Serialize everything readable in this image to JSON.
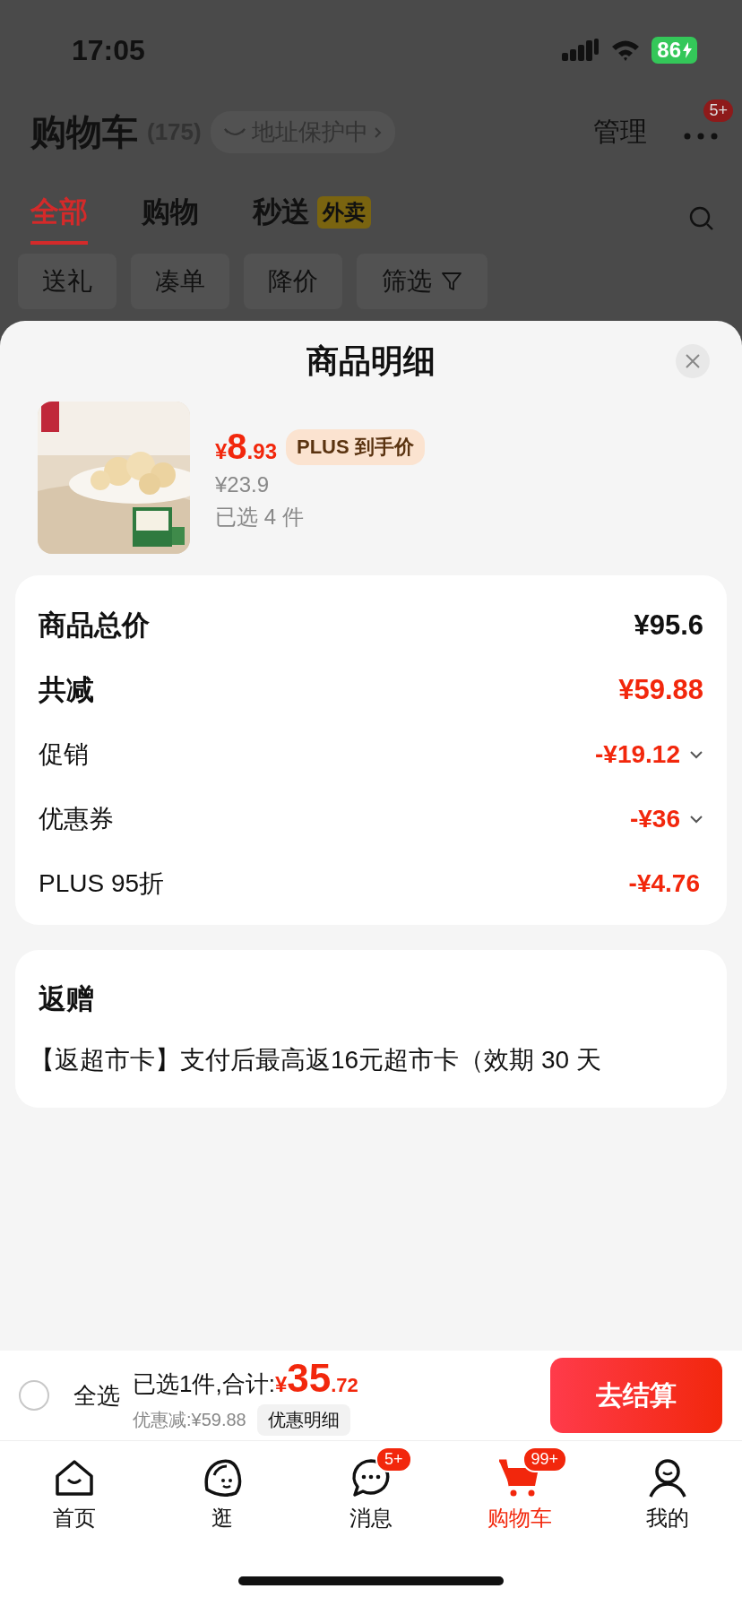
{
  "status_bar": {
    "time": "17:05",
    "battery": "86"
  },
  "header": {
    "title": "购物车",
    "count": "(175)",
    "address_badge": "地址保护中",
    "manage": "管理",
    "more_badge": "5+"
  },
  "tabs": [
    {
      "label": "全部",
      "selected": true
    },
    {
      "label": "购物",
      "selected": false
    },
    {
      "label": "秒送",
      "tag": "外卖",
      "selected": false
    }
  ],
  "filters": [
    {
      "label": "送礼",
      "kind": "chip"
    },
    {
      "label": "凑单",
      "kind": "chip"
    },
    {
      "label": "降价",
      "kind": "chip"
    },
    {
      "label": "筛选",
      "kind": "filter"
    }
  ],
  "sheet": {
    "title": "商品明细",
    "product": {
      "kind": "picture",
      "price_symbol": "¥",
      "price_int": "8",
      "price_dec": ".93",
      "plus_tag": "PLUS 到手价",
      "original_price": "¥23.9",
      "quantity": "已选 4 件"
    },
    "summary": [
      {
        "label": "商品总价",
        "value": "¥95.6",
        "kind": "total"
      },
      {
        "label": "共减",
        "value": "¥59.88",
        "kind": "discount_total"
      },
      {
        "label": "促销",
        "value": "-¥19.12",
        "kind": "detail",
        "expandable": true
      },
      {
        "label": "优惠券",
        "value": "-¥36",
        "kind": "detail",
        "expandable": true
      },
      {
        "label": "PLUS 95折",
        "value": "-¥4.76",
        "kind": "detail",
        "expandable": false
      }
    ],
    "rebate": {
      "title": "返赠",
      "text": "【返超市卡】支付后最高返16元超市卡（效期 30 天"
    }
  },
  "checkout_bar": {
    "select_all": {
      "label": "全选",
      "checked": false
    },
    "summary": "已选1件,合计:",
    "total_symbol": "¥",
    "total_int": "35",
    "total_dec": ".72",
    "discount": "优惠减:¥59.88",
    "detail_button": "优惠明细",
    "checkout": "去结算"
  },
  "nav": [
    {
      "label": "首页",
      "kind": "home",
      "selected": false
    },
    {
      "label": "逛",
      "kind": "browse",
      "selected": false
    },
    {
      "label": "消息",
      "kind": "messages",
      "badge": "5+",
      "selected": false
    },
    {
      "label": "购物车",
      "kind": "cart",
      "badge": "99+",
      "selected": true
    },
    {
      "label": "我的",
      "kind": "profile",
      "selected": false
    }
  ]
}
